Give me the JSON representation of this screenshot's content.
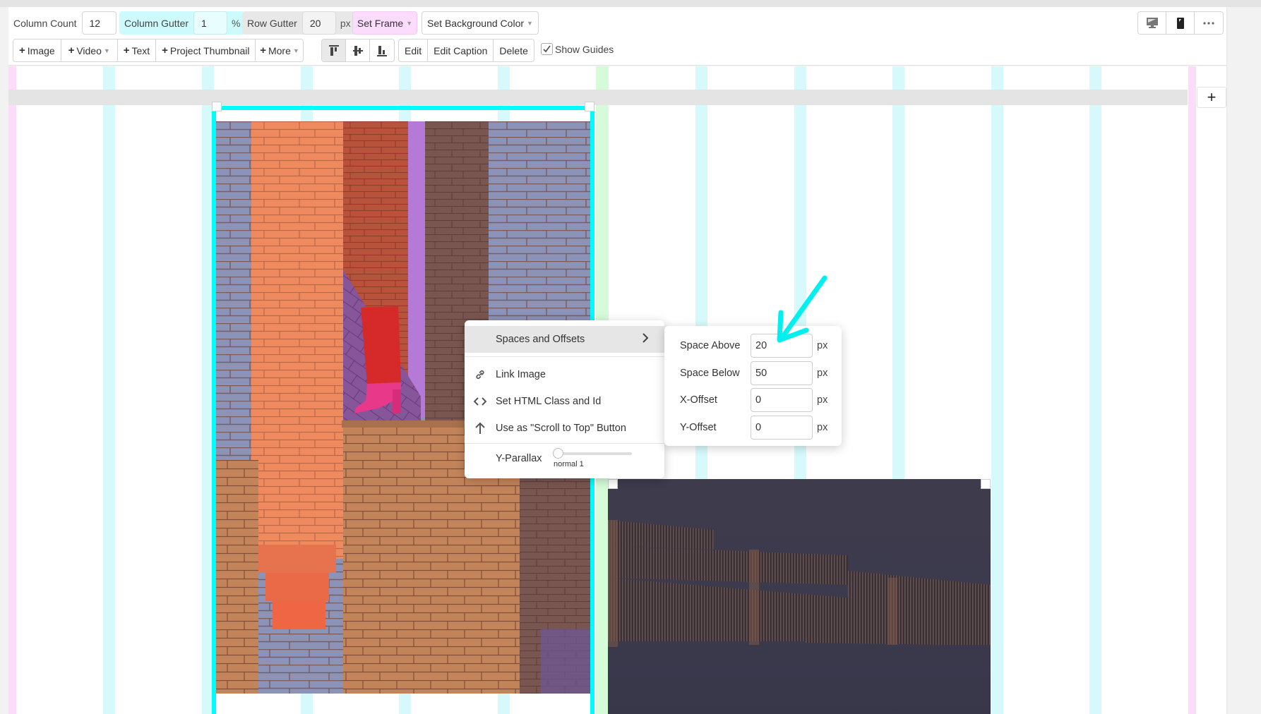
{
  "toolbar": {
    "column_count": {
      "label": "Column Count",
      "value": "12"
    },
    "column_gutter": {
      "label": "Column Gutter",
      "value": "1",
      "unit": "%"
    },
    "row_gutter": {
      "label": "Row Gutter",
      "value": "20",
      "unit": "px"
    },
    "set_frame": "Set Frame",
    "set_background_color": "Set Background Color",
    "add_buttons": [
      {
        "label": "Image",
        "has_caret": false
      },
      {
        "label": "Video",
        "has_caret": true
      },
      {
        "label": "Text",
        "has_caret": false
      },
      {
        "label": "Project Thumbnail",
        "has_caret": false
      },
      {
        "label": "More",
        "has_caret": true
      }
    ],
    "align_buttons": [
      {
        "icon": "align-top-icon",
        "active": true
      },
      {
        "icon": "align-middle-icon",
        "active": false
      },
      {
        "icon": "align-bottom-icon",
        "active": false
      }
    ],
    "edit": "Edit",
    "edit_caption": "Edit Caption",
    "delete": "Delete",
    "show_guides": {
      "label": "Show Guides",
      "checked": true
    },
    "view_buttons": [
      {
        "icon": "desktop-icon"
      },
      {
        "icon": "mobile-icon"
      },
      {
        "icon": "more-dots-icon"
      }
    ]
  },
  "canvas": {
    "add_row_label": "+",
    "guide_colors": {
      "column": "#d6fafb",
      "margin": "#fcdcf8",
      "highlight": "#d5fbd9",
      "selection": "#00fcfd"
    }
  },
  "context_menu": {
    "items": [
      {
        "label": "Spaces and Offsets",
        "icon": "",
        "has_submenu": true,
        "highlighted": true
      },
      {
        "label": "Link Image",
        "icon": "link-icon"
      },
      {
        "label": "Set HTML Class and Id",
        "icon": "code-icon"
      },
      {
        "label": "Use as \"Scroll to Top\" Button",
        "icon": "arrow-up-icon"
      }
    ],
    "parallax": {
      "label": "Y-Parallax",
      "value_label": "normal 1",
      "value": 1
    }
  },
  "submenu": {
    "rows": [
      {
        "label": "Space Above",
        "value": "20",
        "unit": "px"
      },
      {
        "label": "Space Below",
        "value": "50",
        "unit": "px"
      },
      {
        "label": "X-Offset",
        "value": "0",
        "unit": "px"
      },
      {
        "label": "Y-Offset",
        "value": "0",
        "unit": "px"
      }
    ]
  }
}
